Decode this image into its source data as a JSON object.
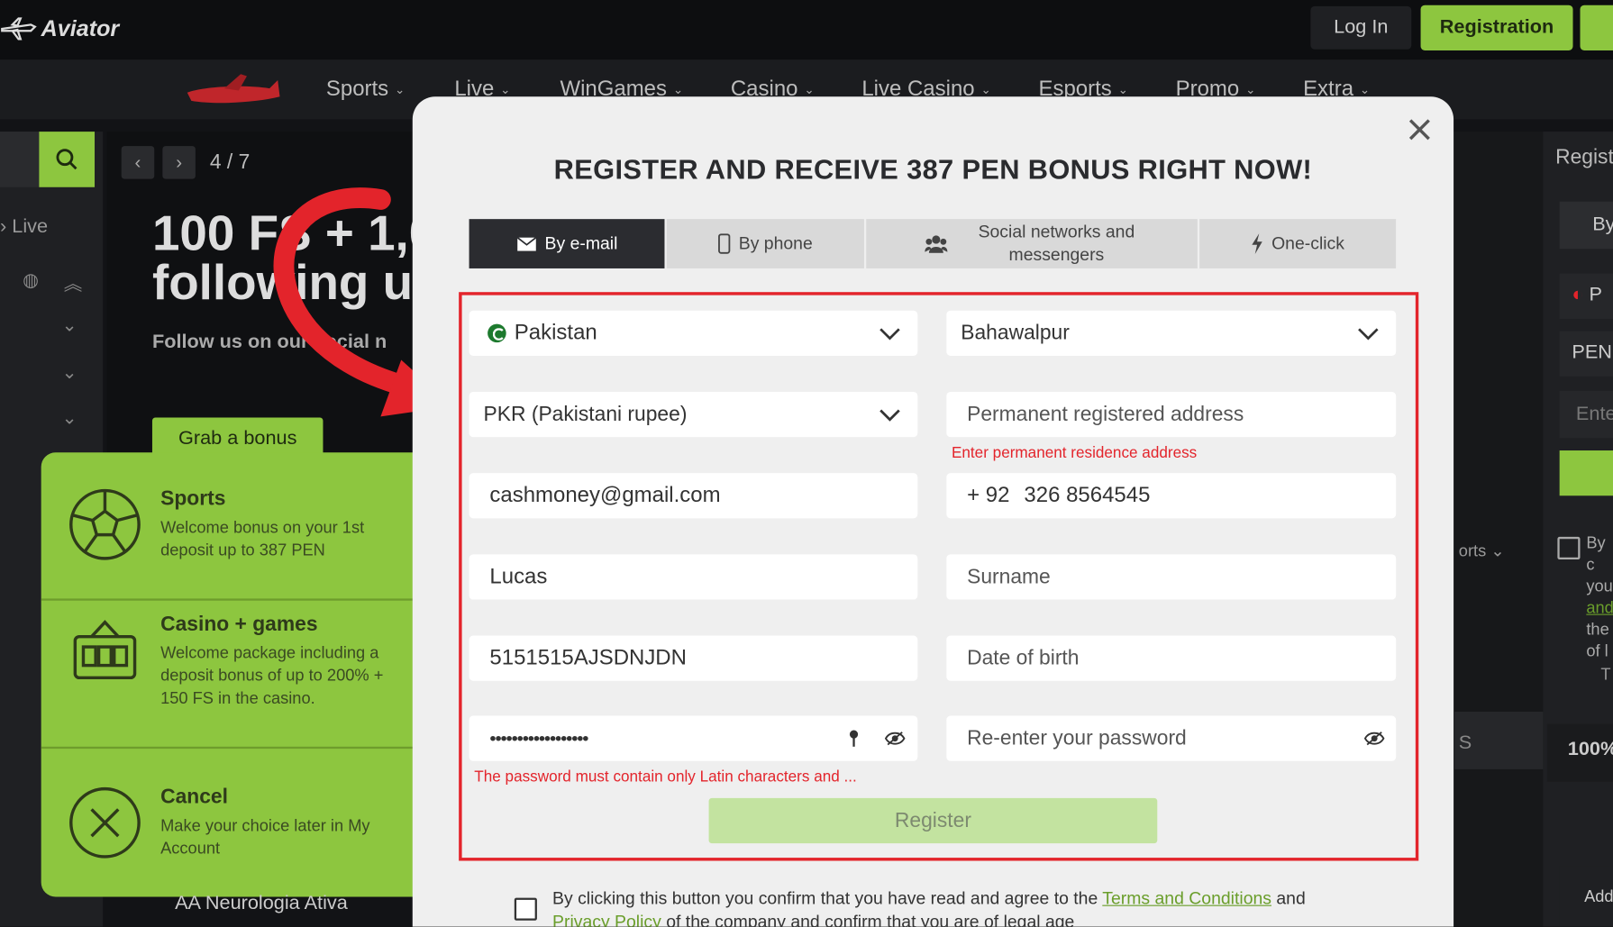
{
  "header": {
    "logo_text": "Aviator",
    "login_label": "Log In",
    "registration_label": "Registration"
  },
  "nav": {
    "items": [
      "Sports",
      "Live",
      "WinGames",
      "Casino",
      "Live Casino",
      "Esports",
      "Promo",
      "Extra"
    ]
  },
  "sidebar": {
    "live_label": "Live"
  },
  "banner": {
    "pager": "4 / 7",
    "title": "100 FS + 1,0\nfollowing u",
    "subtitle": "Follow us on our social n",
    "grab_label": "Grab a bonus"
  },
  "bonus_options": [
    {
      "title": "Sports",
      "desc": "Welcome bonus on your 1st deposit up to 387 PEN",
      "icon": "soccer-ball-icon"
    },
    {
      "title": "Casino + games",
      "desc": "Welcome package including a deposit bonus of up to 200% + 150 FS in the casino.",
      "icon": "slot-machine-icon"
    },
    {
      "title": "Cancel",
      "desc": "Make your choice later in My Account",
      "icon": "close-circle-icon"
    }
  ],
  "left_list_item": "AA Neurologia Ativa",
  "modal": {
    "title": "REGISTER AND RECEIVE 387 PEN BONUS RIGHT NOW!",
    "tabs": [
      {
        "label": "By e-mail",
        "icon": "envelope-icon",
        "active": true
      },
      {
        "label": "By phone",
        "icon": "phone-icon",
        "active": false
      },
      {
        "label": "Social networks and messengers",
        "icon": "people-icon",
        "active": false
      },
      {
        "label": "One-click",
        "icon": "lightning-icon",
        "active": false
      }
    ],
    "form": {
      "country": "Pakistan",
      "city": "Bahawalpur",
      "currency": "PKR (Pakistani rupee)",
      "address_placeholder": "Permanent registered address",
      "address_error": "Enter permanent residence address",
      "email": "cashmoney@gmail.com",
      "phone_code": "+ 92",
      "phone_number": "326 8564545",
      "name": "Lucas",
      "surname_placeholder": "Surname",
      "promo_code": "5151515AJSDNJDN",
      "dob_placeholder": "Date of birth",
      "password_mask": "••••••••••••••••••",
      "repassword_placeholder": "Re-enter your password",
      "password_error": "The password must contain only Latin characters and ...",
      "register_label": "Register"
    },
    "terms": {
      "pre": "By clicking this button you confirm that you have read and agree to the ",
      "link1": "Terms and Conditions",
      "mid": " and",
      "link2": "Privacy Policy",
      "post": " of the company and confirm that you are of legal age"
    }
  },
  "right_panel": {
    "regist": "Regist",
    "by": "By",
    "p": "P",
    "pen": "PEN",
    "ente": "Ente",
    "sports": "orts",
    "by2": "By c",
    "you": "you",
    "and": "and",
    "the": "the",
    "of": "of l",
    "t": "T",
    "pct": "100%",
    "s": "S",
    "add": "Add"
  },
  "colors": {
    "accent": "#8dc63f",
    "error": "#e3242b",
    "modal_bg": "#efefef"
  }
}
